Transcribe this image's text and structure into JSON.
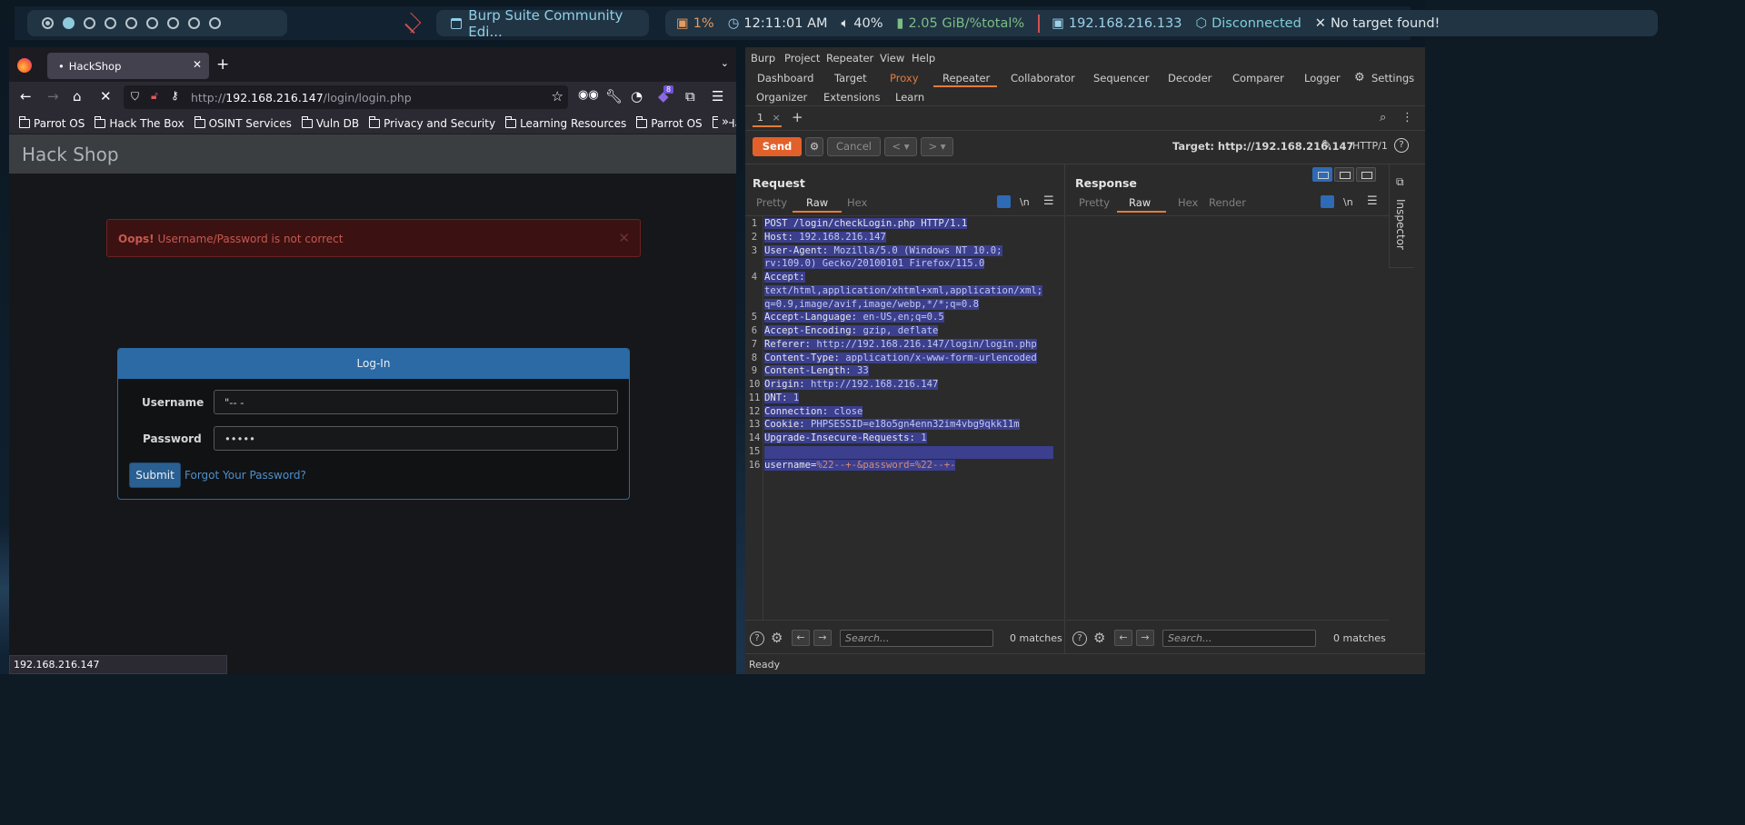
{
  "panel": {
    "window_title": "Burp Suite Community Edi...",
    "cpu": "1%",
    "time": "12:11:01 AM",
    "volume": "40%",
    "memory": "2.05 GiB/%total%",
    "ip": "192.168.216.133",
    "vpn": "Disconnected",
    "target": "No target found!",
    "colors": {
      "cpu": "#e59a5f",
      "memory": "#7bbe84",
      "ip": "#9dd1e8",
      "vpn": "#7ecfd8",
      "accent_red": "#d3504f"
    }
  },
  "firefox": {
    "tab_title": "HackShop",
    "url_host": "192.168.216.147",
    "url_prefix": "http://",
    "url_path": "/login/login.php",
    "bookmarks": [
      "Parrot OS",
      "Hack The Box",
      "OSINT Services",
      "Vuln DB",
      "Privacy and Security",
      "Learning Resources",
      "Parrot OS",
      "Hack The Box"
    ],
    "extension_badge": "8",
    "status_url": "192.168.216.147"
  },
  "page": {
    "brand": "Hack Shop",
    "alert_strong": "Oops!",
    "alert_text": " Username/Password is not correct",
    "panel_title": "Log-In",
    "username_label": "Username",
    "username_value": "\"-- -",
    "password_label": "Password",
    "password_value": "•••••",
    "submit_label": "Submit",
    "forgot_label": "Forgot Your Password?"
  },
  "burp": {
    "menu": [
      "Burp",
      "Project",
      "Repeater",
      "View",
      "Help"
    ],
    "tabs_row1": [
      "Dashboard",
      "Target",
      "Proxy",
      "Repeater",
      "Collaborator",
      "Sequencer",
      "Decoder",
      "Comparer",
      "Logger"
    ],
    "settings_label": "Settings",
    "tabs_row2": [
      "Organizer",
      "Extensions",
      "Learn"
    ],
    "repeater_tab": "1",
    "send_label": "Send",
    "cancel_label": "Cancel",
    "target_label": "Target: http://192.168.216.147",
    "http_version": "HTTP/1",
    "request_title": "Request",
    "response_title": "Response",
    "request_views": [
      "Pretty",
      "Raw",
      "Hex"
    ],
    "response_views": [
      "Pretty",
      "Raw",
      "Hex",
      "Render"
    ],
    "newline_label": "\\n",
    "request_lines": [
      {
        "n": "1",
        "k": "POST /login/checkLogin.php HTTP/1.1",
        "v": ""
      },
      {
        "n": "2",
        "k": "Host:",
        "v": " 192.168.216.147"
      },
      {
        "n": "3",
        "k": "User-Agent:",
        "v": " Mozilla/5.0 (Windows NT 10.0;"
      },
      {
        "n": "",
        "k": "",
        "v": "rv:109.0) Gecko/20100101 Firefox/115.0"
      },
      {
        "n": "4",
        "k": "Accept:",
        "v": ""
      },
      {
        "n": "",
        "k": "",
        "v": "text/html,application/xhtml+xml,application/xml;"
      },
      {
        "n": "",
        "k": "",
        "v": "q=0.9,image/avif,image/webp,*/*;q=0.8"
      },
      {
        "n": "5",
        "k": "Accept-Language:",
        "v": " en-US,en;q=0.5"
      },
      {
        "n": "6",
        "k": "Accept-Encoding:",
        "v": " gzip, deflate"
      },
      {
        "n": "7",
        "k": "Referer:",
        "v": " http://192.168.216.147/login/login.php"
      },
      {
        "n": "8",
        "k": "Content-Type:",
        "v": " application/x-www-form-urlencoded"
      },
      {
        "n": "9",
        "k": "Content-Length:",
        "v": " 33"
      },
      {
        "n": "10",
        "k": "Origin:",
        "v": " http://192.168.216.147"
      },
      {
        "n": "11",
        "k": "DNT:",
        "v": " 1"
      },
      {
        "n": "12",
        "k": "Connection:",
        "v": " close"
      },
      {
        "n": "13",
        "k": "Cookie:",
        "v": " PHPSESSID=e18o5gn4enn32im4vbg9qkk11m"
      },
      {
        "n": "14",
        "k": "Upgrade-Insecure-Requests:",
        "v": " 1"
      },
      {
        "n": "15",
        "k": "",
        "v": ""
      },
      {
        "n": "16",
        "k": "username=",
        "v": "%22--+-&password=%22--+-"
      }
    ],
    "search_placeholder": "Search...",
    "matches": "0 matches",
    "inspector_label": "Inspector",
    "status": "Ready"
  }
}
